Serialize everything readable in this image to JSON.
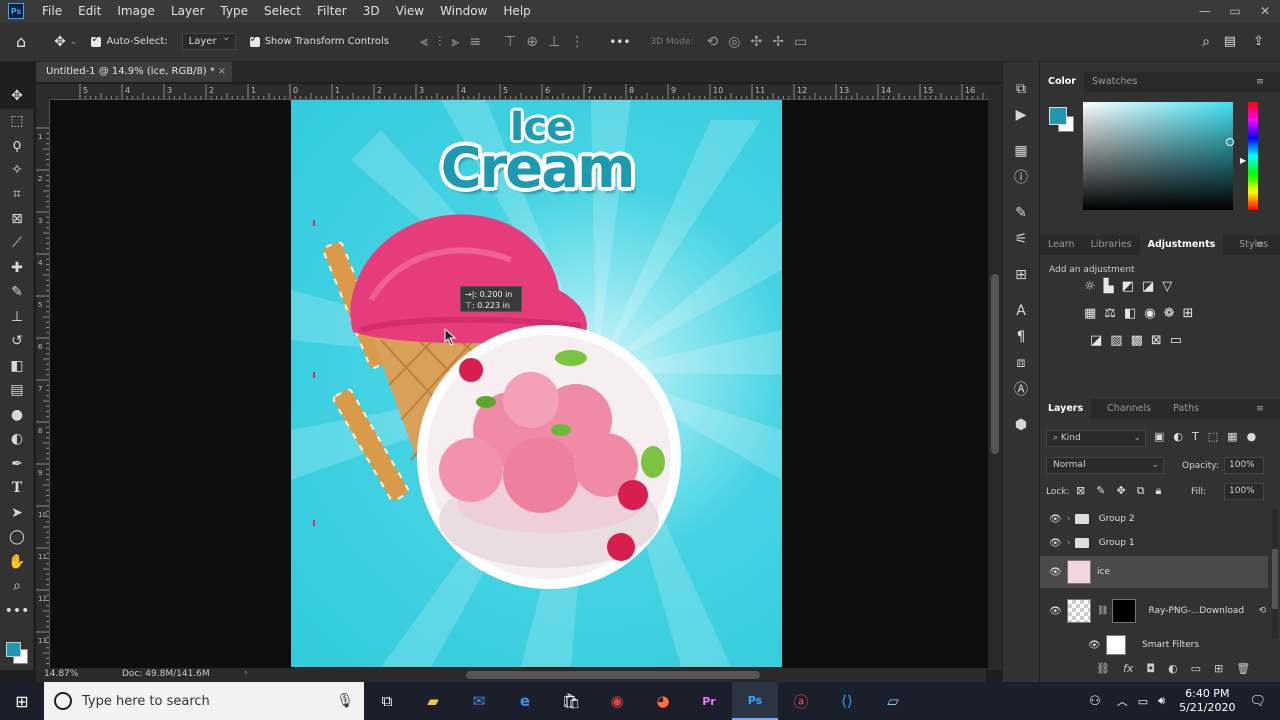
{
  "app": {
    "logo": "Ps",
    "menu": [
      "File",
      "Edit",
      "Image",
      "Layer",
      "Type",
      "Select",
      "Filter",
      "3D",
      "View",
      "Window",
      "Help"
    ],
    "window_controls": [
      "—",
      "▭",
      "✕"
    ]
  },
  "options_bar": {
    "auto_select_label": "Auto-Select:",
    "auto_select_value": "Layer",
    "show_transform_label": "Show Transform Controls",
    "mode_label": "3D Mode:",
    "more": "•••"
  },
  "document": {
    "tab_title": "Untitled-1 @ 14.9% (ice, RGB/8) *",
    "close": "×"
  },
  "ruler": {
    "h_ticks": [
      "5",
      "4",
      "3",
      "2",
      "1",
      "0",
      "1",
      "2",
      "3",
      "4",
      "5",
      "6",
      "7",
      "8",
      "9",
      "10",
      "11",
      "12",
      "13",
      "14",
      "15",
      "16"
    ],
    "v_ticks": [
      "1",
      "2",
      "3",
      "4",
      "5",
      "6",
      "7",
      "8",
      "9",
      "10",
      "11",
      "12",
      "13"
    ]
  },
  "artwork": {
    "title_line1": "Ice",
    "title_line2": "Cream",
    "move_readout_x": "→|: 0.200 in",
    "move_readout_y": "⊤: 0.223 in"
  },
  "status": {
    "zoom": "14.87%",
    "doc_size": "Doc: 49.8M/141.6M"
  },
  "color_panel": {
    "tabs": [
      "Color",
      "Swatches"
    ],
    "foreground": "#1d9ab0",
    "background": "#ffffff"
  },
  "adjust_panel": {
    "tabs": [
      "Learn",
      "Libraries",
      "Adjustments",
      "Styles"
    ],
    "hint": "Add an adjustment"
  },
  "layers_panel": {
    "tabs": [
      "Layers",
      "Channels",
      "Paths"
    ],
    "filter_kind": "Kind",
    "blend_mode": "Normal",
    "opacity_label": "Opacity:",
    "opacity_value": "100%",
    "lock_label": "Lock:",
    "fill_label": "Fill:",
    "fill_value": "100%",
    "layers": [
      {
        "name": "Group 2"
      },
      {
        "name": "Group 1"
      },
      {
        "name": "ice"
      },
      {
        "name": "Ray-PNG-...Download"
      },
      {
        "name": "Smart Filters"
      }
    ]
  },
  "taskbar": {
    "search_placeholder": "Type here to search",
    "time": "6:40 PM",
    "date": "5/21/2020"
  }
}
